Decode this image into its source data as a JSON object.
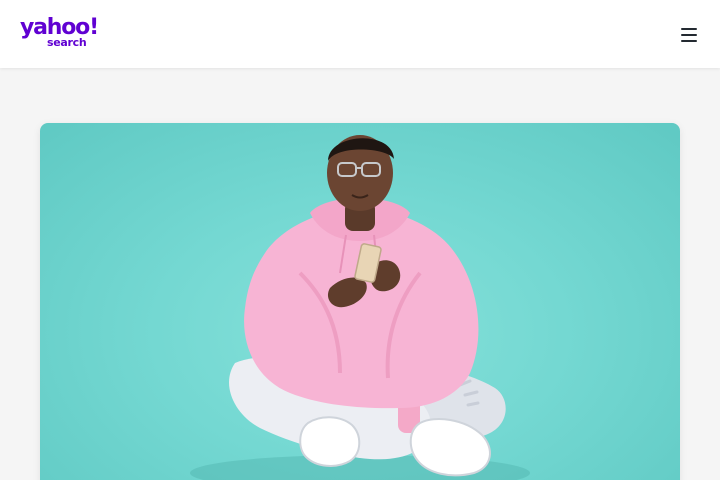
{
  "header": {
    "logo": {
      "word": "yahoo!",
      "sub": "search",
      "color": "#6001d2"
    },
    "menu_icon": "hamburger-menu-icon"
  },
  "hero": {
    "background_color": "#74d8d2",
    "image_subject": "person-with-phone-illustration"
  },
  "colors": {
    "header_bg": "#ffffff",
    "page_bg": "#f5f5f5",
    "hoodie": "#f7b4d4",
    "jeans": "#e6e8ee",
    "icon": "#232a31"
  }
}
